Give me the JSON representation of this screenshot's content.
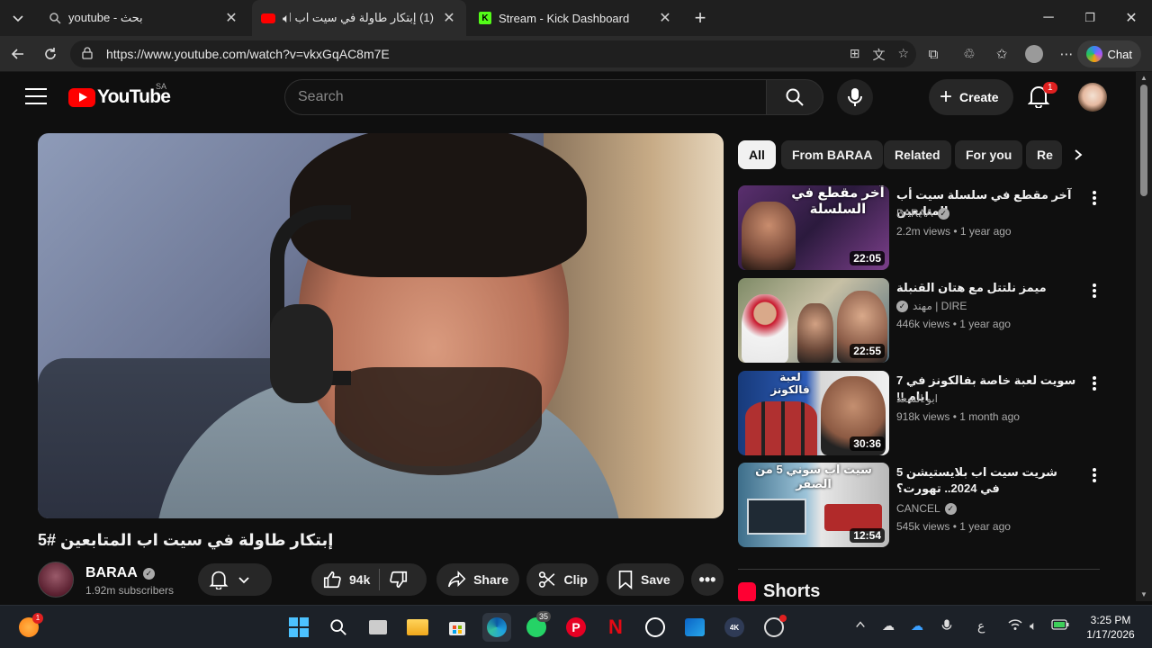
{
  "browser": {
    "tabs": [
      {
        "title": "youtube - بحث"
      },
      {
        "title": "(1) إبتكار طاولة في سيت اب المتابعين #5 - YouTube"
      },
      {
        "title": "Stream - Kick Dashboard"
      }
    ],
    "url": "https://www.youtube.com/watch?v=vkxGqAC8m7E",
    "chat_label": "Chat"
  },
  "youtube": {
    "country_code": "SA",
    "logo_text": "YouTube",
    "search_placeholder": "Search",
    "create_label": "Create",
    "notification_count": "1",
    "video": {
      "title": "إبتكار طاولة في سيت اب المتابعين #5",
      "channel": "BARAA",
      "subscribers": "1.92m subscribers",
      "likes": "94k",
      "share_label": "Share",
      "clip_label": "Clip",
      "save_label": "Save"
    },
    "chips": [
      "All",
      "From BARAA",
      "Related",
      "For you",
      "Re"
    ],
    "recommendations": [
      {
        "title": "آخر مقطع في سلسلة سيت أب المتابعين",
        "channel": "BARAA",
        "verified": true,
        "meta": "2.2m views • 1 year ago",
        "duration": "22:05",
        "thumb_text": "آخر مقطع في السلسلة"
      },
      {
        "title": "ميمز نلتتل مع هتان القنبلة",
        "channel": "مهند | DIRE",
        "verified": true,
        "meta": "446k views • 1 year ago",
        "duration": "22:55",
        "thumb_text": ""
      },
      {
        "title": "سويت لعبة خاصة بفالكونز في 7 ايام !!",
        "channel": "ابو السعد",
        "verified": false,
        "meta": "918k views • 1 month ago",
        "duration": "30:36",
        "thumb_text": "لعبة فالكونز"
      },
      {
        "title": "شريت سيت اب بلايستيشن 5 في 2024.. تهورت؟",
        "channel": "CANCEL",
        "verified": true,
        "meta": "545k views • 1 year ago",
        "duration": "12:54",
        "thumb_text": "سيت اب سوني 5 من الصفر"
      }
    ],
    "shorts_label": "Shorts"
  },
  "taskbar": {
    "whatsapp_badge": "35",
    "tray_lang": "ع",
    "time": "3:25 PM",
    "date": "1/17/2026"
  },
  "colors": {
    "youtube_red": "#ff0000",
    "background": "#0f0f0f",
    "chip_selected": "#f1f1f1",
    "kick_green": "#53fc18"
  }
}
